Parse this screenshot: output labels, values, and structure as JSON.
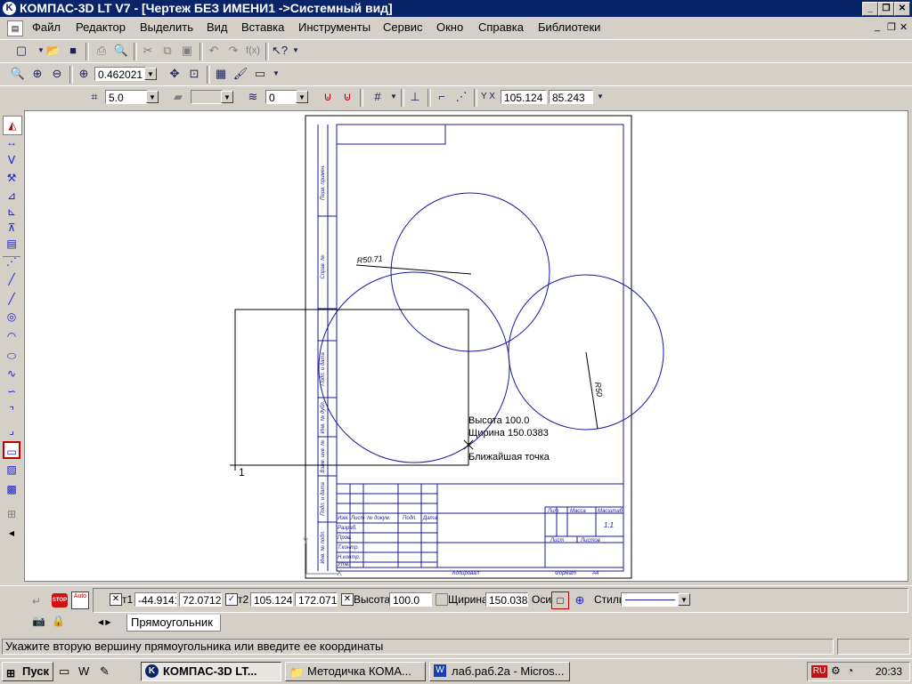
{
  "window": {
    "title": "КОМПАС-3D LT V7 - [Чертеж БЕЗ ИМЕНИ1 ->Системный вид]",
    "app_icon": "kompas-icon"
  },
  "menu": [
    "Файл",
    "Редактор",
    "Выделить",
    "Вид",
    "Вставка",
    "Инструменты",
    "Сервис",
    "Окно",
    "Справка",
    "Библиотеки"
  ],
  "toolbar": {
    "zoom_value": "0.462021",
    "step_value": "5.0",
    "layer_value": "0",
    "cursor_x": "105.124",
    "cursor_y": "85.243"
  },
  "drawing": {
    "radius_label_1": "R50.71",
    "radius_label_2": "R50",
    "rect_height_tip": "Высота 100.0",
    "rect_width_tip": "Щирина 150.0383",
    "snap_tip": "Ближайшая точка",
    "corner_label": "1",
    "frame_labels": {
      "perv_primen": "Перв. примен.",
      "sprav_no": "Справ. №",
      "podp_data_1": "Подп. и дата",
      "inv_dubl": "Инв. № дубл.",
      "vzam_inv": "Взам. инв. №",
      "podp_data_2": "Подп. и дата",
      "inv_podl": "Инв. № подл.",
      "izm": "Изм.",
      "list": "Лист",
      "n_dokum": "№ докум.",
      "podp": "Подп.",
      "data": "Дата",
      "razrab": "Разраб.",
      "prov": "Пров.",
      "t_kontr": "Т.контр.",
      "n_kontr": "Н.контр.",
      "utv": "Утв.",
      "lit": "Лит",
      "massa": "Масса",
      "masshtab": "Масштаб",
      "scale_value": "1:1",
      "list2": "Лист",
      "listov": "Листов",
      "kopiroval": "Копировал",
      "format": "Формат",
      "format_value": "А4"
    }
  },
  "property_bar": {
    "t1_x": "-44.9141",
    "t1_y": "72.0712",
    "t1_label": "т1",
    "t2_x": "105.124",
    "t2_y": "172.071",
    "t2_label": "т2",
    "height_label": "Высота",
    "height_value": "100.0",
    "width_label": "Щирина",
    "width_value": "150.038",
    "axes_label": "Оси",
    "style_label": "Стиль",
    "tab_label": "Прямоугольник",
    "stop_label": "STOP",
    "auto_label": "Auto"
  },
  "status_text": "Укажите вторую вершину прямоугольника или введите ее координаты",
  "taskbar": {
    "start_label": "Пуск",
    "tasks": [
      "КОМПАС-3D LT...",
      "Методичка КОМА...",
      "лаб.раб.2а - Micros..."
    ],
    "lang": "RU",
    "clock": "20:33"
  },
  "colors": {
    "titlebar": "#0a246a",
    "drawing_line": "#1a1aa0",
    "frame_line": "#1a1a9a"
  }
}
